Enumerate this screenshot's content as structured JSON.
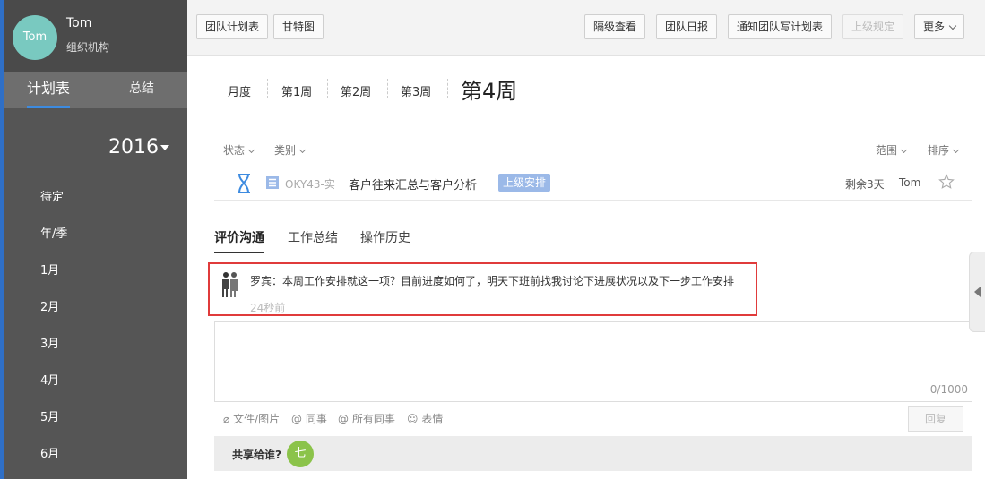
{
  "user": {
    "avatar_text": "Tom",
    "name": "Tom",
    "org": "组织机构"
  },
  "sidebar": {
    "tabs": [
      {
        "label": "计划表"
      },
      {
        "label": "总结"
      }
    ],
    "year": "2016",
    "items": [
      {
        "label": "待定"
      },
      {
        "label": "年/季"
      },
      {
        "label": "1月"
      },
      {
        "label": "2月"
      },
      {
        "label": "3月"
      },
      {
        "label": "4月"
      },
      {
        "label": "5月"
      },
      {
        "label": "6月"
      }
    ]
  },
  "toolbar": {
    "team_plan": "团队计划表",
    "gantt": "甘特图",
    "skip_view": "隔级查看",
    "team_daily": "团队日报",
    "notify_team": "通知团队写计划表",
    "superior_rule": "上级规定",
    "more": "更多"
  },
  "weeks": {
    "month": "月度",
    "w1": "第1周",
    "w2": "第2周",
    "w3": "第3周",
    "current": "第4周"
  },
  "filters": {
    "status": "状态",
    "category": "类别",
    "scope": "范围",
    "sort": "排序"
  },
  "task": {
    "code": "OKY43-实",
    "title": "客户往来汇总与客户分析",
    "badge": "上级安排",
    "remaining": "剩余3天",
    "owner": "Tom"
  },
  "comment_tabs": {
    "review": "评价沟通",
    "summary": "工作总结",
    "history": "操作历史"
  },
  "comment": {
    "text": "罗宾：本周工作安排就这一项？目前进度如何了，明天下班前找我讨论下进展状况以及下一步工作安排",
    "time": "24秒前"
  },
  "reply": {
    "counter": "0/1000",
    "attach": "文件/图片",
    "mention_colleague": "同事",
    "mention_all": "所有同事",
    "emoji": "表情",
    "submit": "回复"
  },
  "share": {
    "label": "共享给谁?",
    "user_initial": "七"
  },
  "colors": {
    "sidebar": "#555555",
    "accent": "#3d8be0",
    "highlight": "#e03b3b",
    "badge": "#9bb9e8"
  }
}
